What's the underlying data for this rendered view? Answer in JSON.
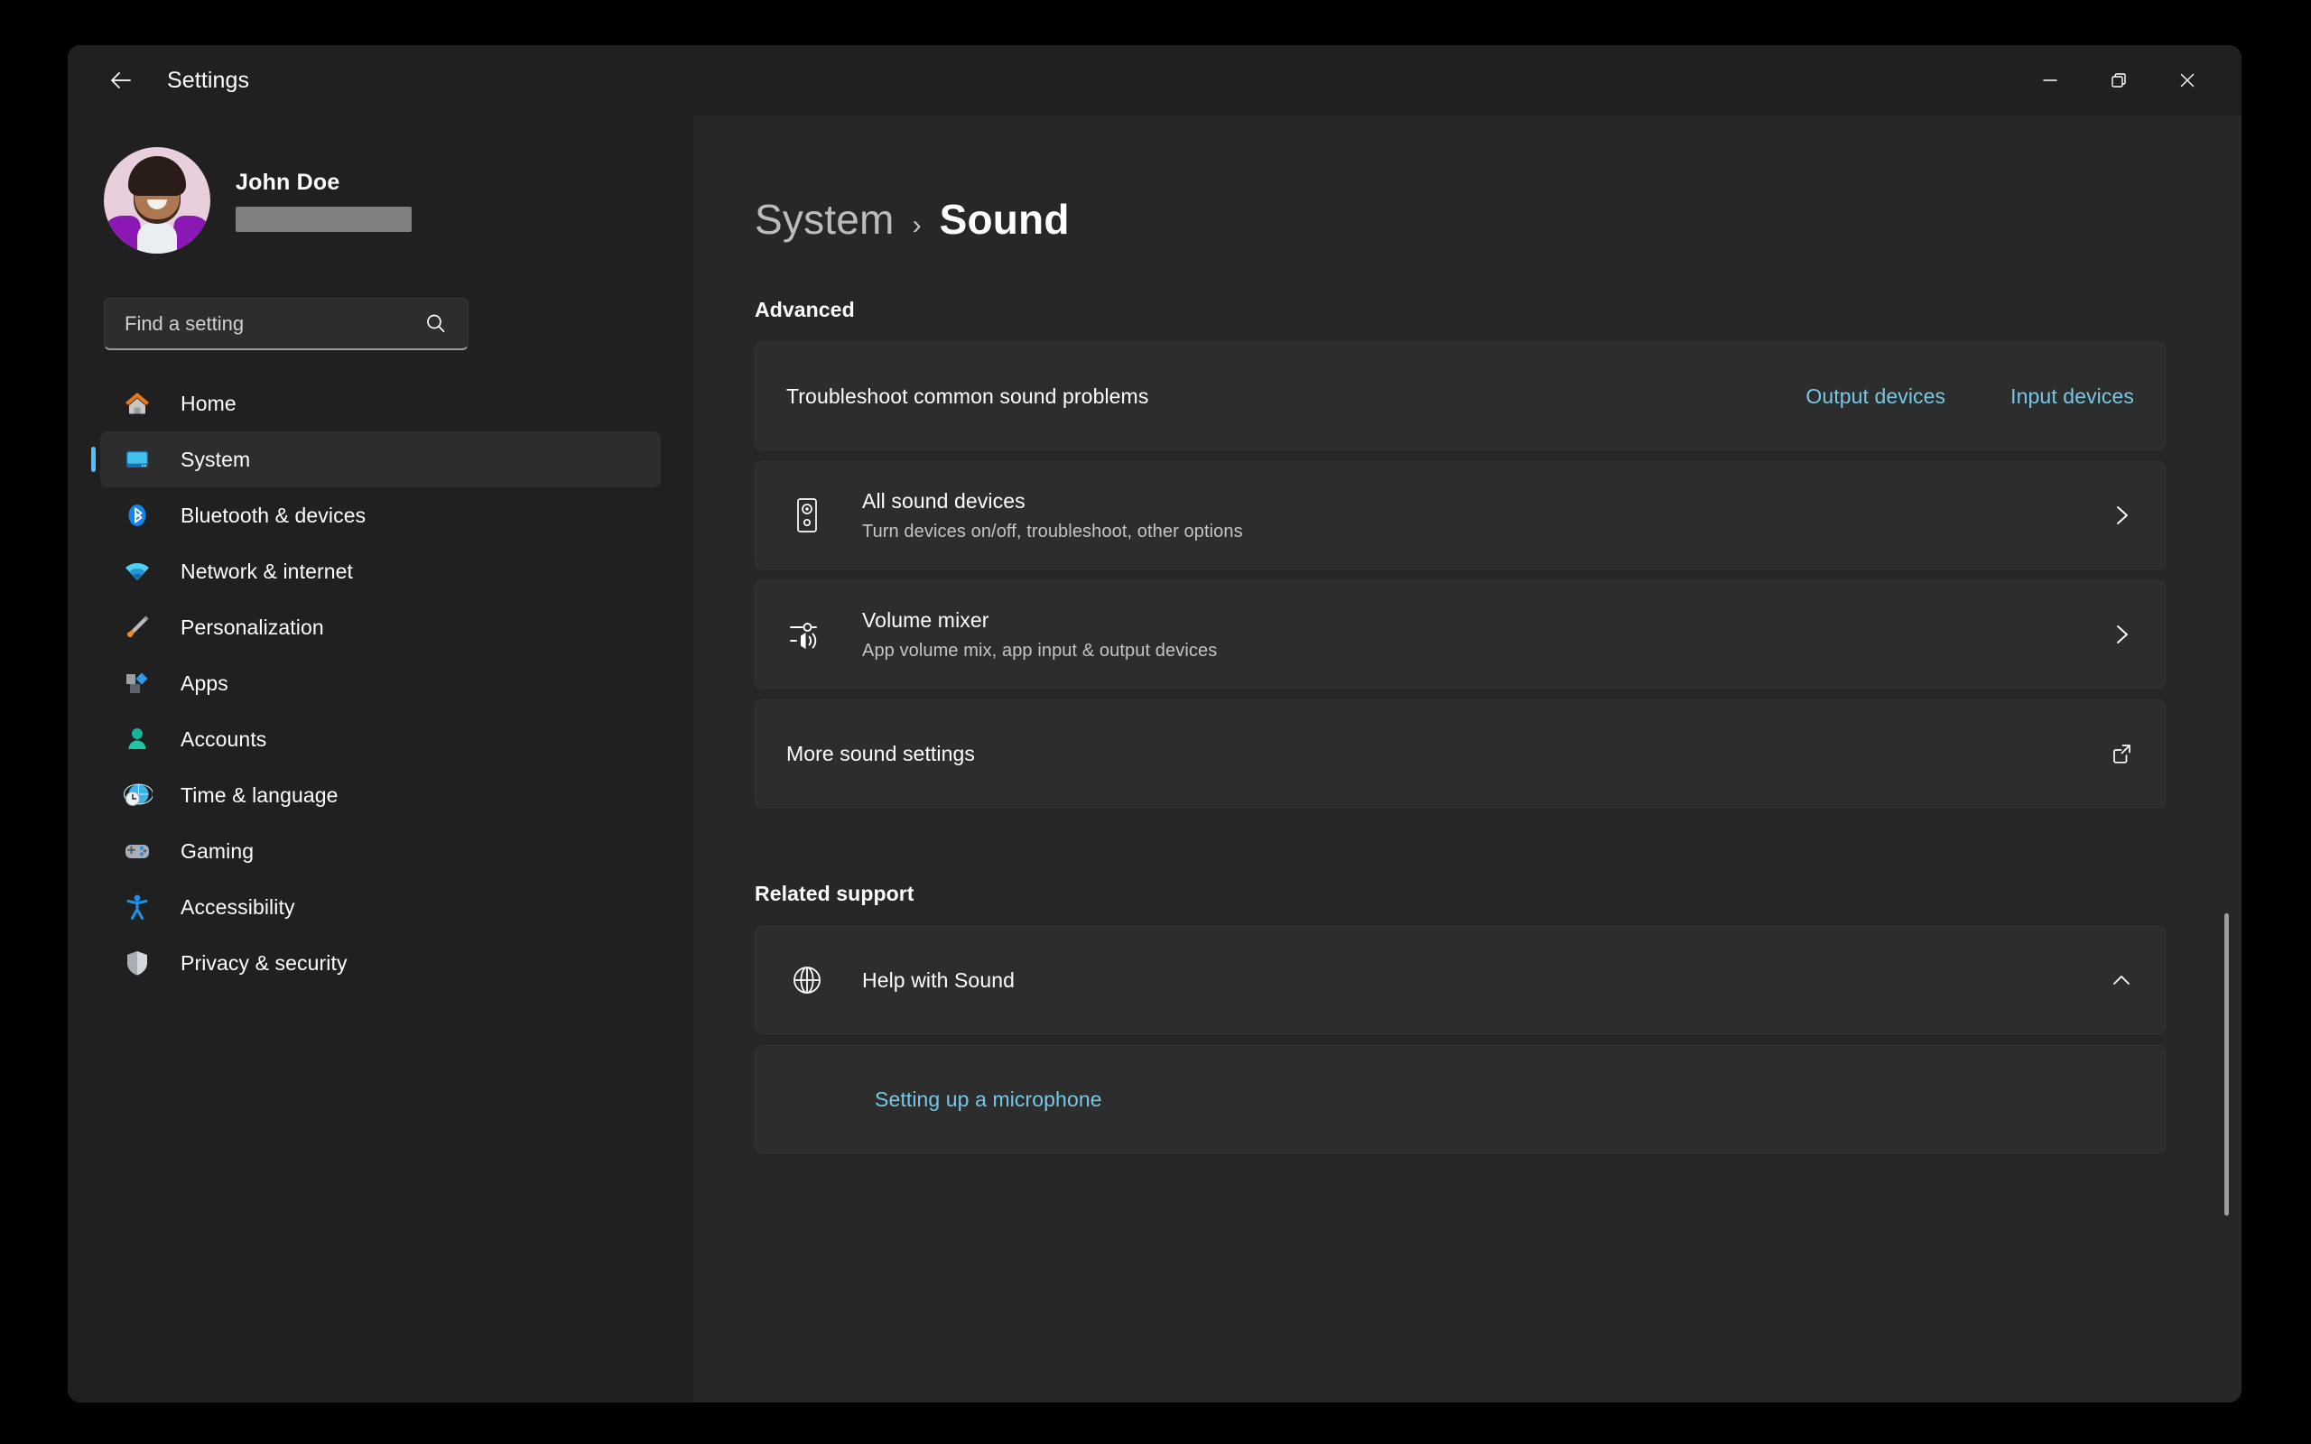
{
  "window": {
    "app_title": "Settings",
    "back_icon": "arrow-left-icon",
    "controls": {
      "minimize_icon": "minimize-icon",
      "restore_icon": "restore-icon",
      "close_icon": "close-icon"
    }
  },
  "sidebar": {
    "profile": {
      "name": "John Doe",
      "email_redacted": true,
      "avatar_icon": "user-avatar"
    },
    "search": {
      "placeholder": "Find a setting",
      "value": "",
      "icon": "search-icon"
    },
    "items": [
      {
        "label": "Home",
        "icon": "home-icon",
        "selected": false
      },
      {
        "label": "System",
        "icon": "monitor-icon",
        "selected": true
      },
      {
        "label": "Bluetooth & devices",
        "icon": "bluetooth-icon",
        "selected": false
      },
      {
        "label": "Network & internet",
        "icon": "wifi-icon",
        "selected": false
      },
      {
        "label": "Personalization",
        "icon": "paintbrush-icon",
        "selected": false
      },
      {
        "label": "Apps",
        "icon": "apps-icon",
        "selected": false
      },
      {
        "label": "Accounts",
        "icon": "person-icon",
        "selected": false
      },
      {
        "label": "Time & language",
        "icon": "globe-clock-icon",
        "selected": false
      },
      {
        "label": "Gaming",
        "icon": "gamepad-icon",
        "selected": false
      },
      {
        "label": "Accessibility",
        "icon": "accessibility-icon",
        "selected": false
      },
      {
        "label": "Privacy & security",
        "icon": "shield-icon",
        "selected": false
      }
    ]
  },
  "main": {
    "breadcrumb": {
      "parent": "System",
      "separator": "›",
      "current": "Sound"
    },
    "advanced": {
      "heading": "Advanced",
      "troubleshoot": {
        "title": "Troubleshoot common sound problems",
        "output_link": "Output devices",
        "input_link": "Input devices"
      },
      "all_sound_devices": {
        "title": "All sound devices",
        "subtitle": "Turn devices on/off, troubleshoot, other options",
        "icon": "speaker-icon",
        "chevron": "chevron-right-icon"
      },
      "volume_mixer": {
        "title": "Volume mixer",
        "subtitle": "App volume mix, app input & output devices",
        "icon": "volume-mixer-icon",
        "chevron": "chevron-right-icon"
      },
      "more_sound_settings": {
        "title": "More sound settings",
        "icon": "external-link-icon"
      }
    },
    "related_support": {
      "heading": "Related support",
      "help": {
        "title": "Help with Sound",
        "icon": "help-globe-icon",
        "chevron": "chevron-up-icon",
        "expanded": true
      },
      "links": [
        {
          "label": "Setting up a microphone"
        }
      ]
    },
    "scrollbar": {
      "icon": "scrollbar-thumb"
    }
  },
  "colors": {
    "accent": "#4cc2ff",
    "link": "#76c8e6",
    "window_bg": "#202020",
    "content_bg": "#272727",
    "card_bg": "#2d2d2d"
  }
}
